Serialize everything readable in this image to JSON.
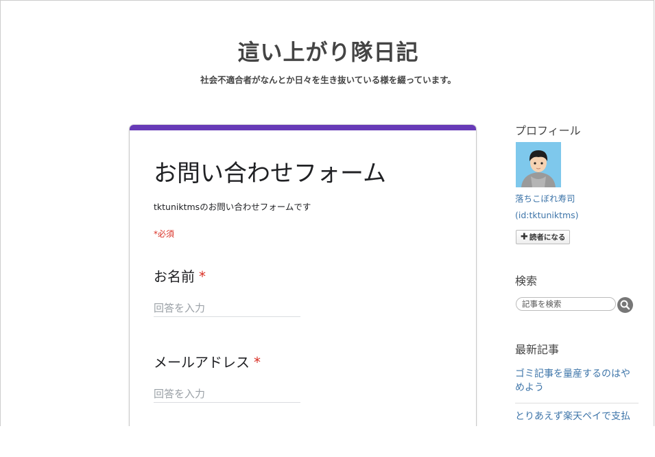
{
  "header": {
    "title": "這い上がり隊日記",
    "description": "社会不適合者がなんとか日々を生き抜いている様を綴っています。"
  },
  "form": {
    "title": "お問い合わせフォーム",
    "description": "tktuniktmsのお問い合わせフォームです",
    "required_note": "*必須",
    "accent_color": "#673ab7",
    "questions": [
      {
        "label": "お名前",
        "required_mark": "*",
        "placeholder": "回答を入力"
      },
      {
        "label": "メールアドレス",
        "required_mark": "*",
        "placeholder": "回答を入力"
      }
    ]
  },
  "sidebar": {
    "profile": {
      "heading": "プロフィール",
      "name": "落ちこぼれ寿司",
      "id": "(id:tktuniktms)",
      "follow_button": "読者になる"
    },
    "search": {
      "heading": "検索",
      "placeholder": "記事を検索",
      "icon": "search-icon"
    },
    "recent": {
      "heading": "最新記事",
      "items": [
        "ゴミ記事を量産するのはや\nめよう",
        "とりあえず楽天ペイで支払"
      ]
    }
  }
}
